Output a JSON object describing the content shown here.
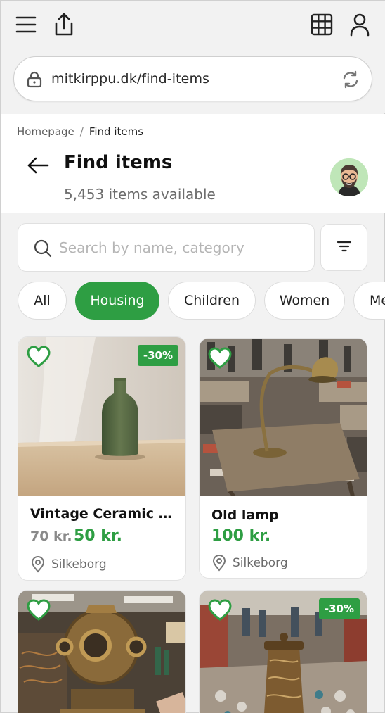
{
  "browser": {
    "url": "mitkirppu.dk/find-items"
  },
  "breadcrumb": {
    "home": "Homepage",
    "separator": "/",
    "current": "Find items"
  },
  "header": {
    "title": "Find items",
    "count": "5,453 items available"
  },
  "search": {
    "placeholder": "Search by name, category",
    "value": ""
  },
  "chips": [
    {
      "label": "All",
      "active": false
    },
    {
      "label": "Housing",
      "active": true
    },
    {
      "label": "Children",
      "active": false
    },
    {
      "label": "Women",
      "active": false
    },
    {
      "label": "Me",
      "active": false
    }
  ],
  "products": [
    {
      "name": "Vintage Ceramic V...",
      "old_price": "70 kr.",
      "price": "50 kr.",
      "location": "Silkeborg",
      "badge": "-30%"
    },
    {
      "name": "Old lamp",
      "old_price": "",
      "price": "100 kr.",
      "location": "Silkeborg",
      "badge": ""
    },
    {
      "name": "",
      "old_price": "",
      "price": "",
      "location": "",
      "badge": ""
    },
    {
      "name": "",
      "old_price": "",
      "price": "",
      "location": "",
      "badge": "-30%"
    }
  ],
  "colors": {
    "accent": "#2e9e43",
    "background": "#f2f2f2",
    "avatar_bg": "#bfe6b8"
  },
  "icons": {
    "menu": "hamburger-menu-icon",
    "share": "share-icon",
    "grid": "grid-icon",
    "user": "user-icon",
    "lock": "lock-icon",
    "reload": "reload-icon",
    "back": "arrow-left-icon",
    "search": "search-icon",
    "filter": "filter-icon",
    "heart": "heart-icon",
    "location": "location-pin-icon"
  }
}
